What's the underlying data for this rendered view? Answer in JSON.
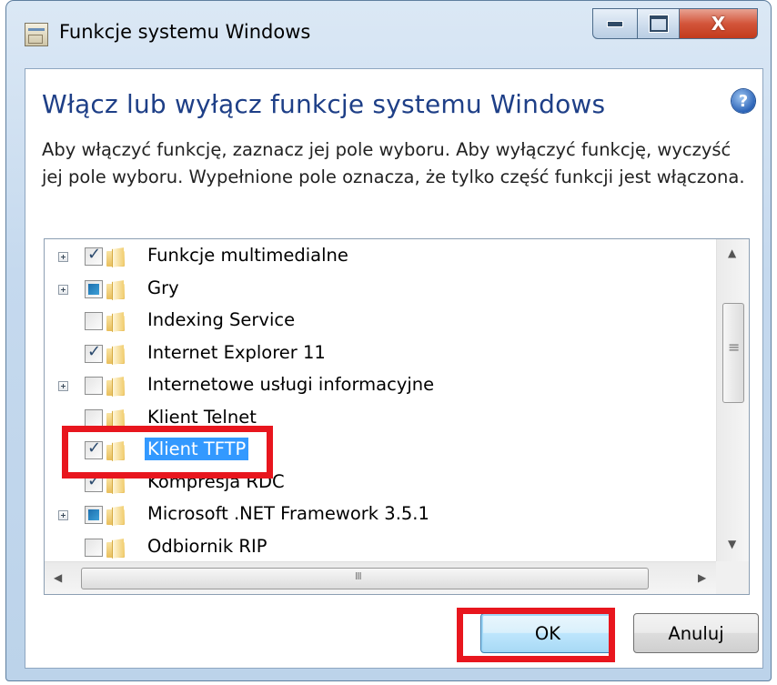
{
  "window": {
    "title": "Funkcje systemu Windows",
    "controls": {
      "minimize": "minimize",
      "maximize": "maximize",
      "close": "X"
    }
  },
  "main": {
    "heading": "Włącz lub wyłącz funkcje systemu Windows",
    "help": "?",
    "description": "Aby włączyć funkcję, zaznacz jej pole wyboru. Aby wyłączyć funkcję, wyczyść jej pole wyboru. Wypełnione pole oznacza, że tylko część funkcji jest włączona."
  },
  "features": [
    {
      "label": "Funkcje multimedialne",
      "state": "checked",
      "expandable": true
    },
    {
      "label": "Gry",
      "state": "partial",
      "expandable": true
    },
    {
      "label": "Indexing Service",
      "state": "unchecked",
      "expandable": false
    },
    {
      "label": "Internet Explorer 11",
      "state": "checked",
      "expandable": false
    },
    {
      "label": "Internetowe usługi informacyjne",
      "state": "unchecked",
      "expandable": true
    },
    {
      "label": "Klient Telnet",
      "state": "unchecked",
      "expandable": false
    },
    {
      "label": "Klient TFTP",
      "state": "checked",
      "expandable": false,
      "selected": true
    },
    {
      "label": "Kompresja RDC",
      "state": "checked",
      "expandable": false
    },
    {
      "label": "Microsoft .NET Framework 3.5.1",
      "state": "partial",
      "expandable": true
    },
    {
      "label": "Odbiornik RIP",
      "state": "unchecked",
      "expandable": false
    }
  ],
  "buttons": {
    "ok": "OK",
    "cancel": "Anuluj"
  },
  "colors": {
    "heading": "#1e3f87",
    "selection": "#3399ff",
    "annotation": "#e8161e"
  }
}
